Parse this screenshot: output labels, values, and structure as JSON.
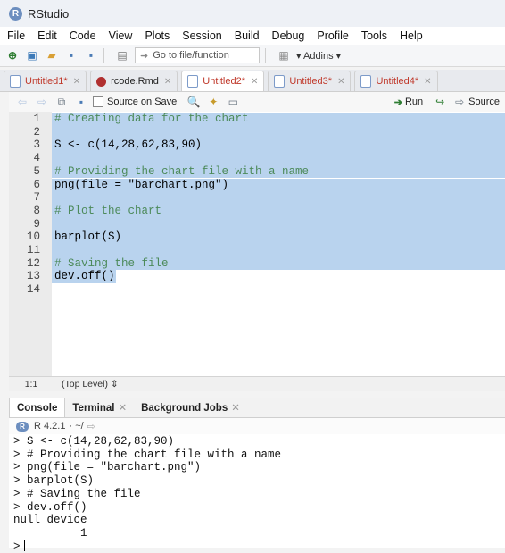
{
  "app": {
    "title": "RStudio",
    "logo_letter": "R"
  },
  "menu": [
    "File",
    "Edit",
    "Code",
    "View",
    "Plots",
    "Session",
    "Build",
    "Debug",
    "Profile",
    "Tools",
    "Help"
  ],
  "toolbar": {
    "goto_placeholder": "Go to file/function",
    "addins_label": "Addins"
  },
  "tabs": [
    {
      "label": "Untitled1*",
      "active": false
    },
    {
      "label": "rcode.Rmd",
      "active": false
    },
    {
      "label": "Untitled2*",
      "active": true
    },
    {
      "label": "Untitled3*",
      "active": false
    },
    {
      "label": "Untitled4*",
      "active": false
    }
  ],
  "editor_toolbar": {
    "source_on_save": "Source on Save",
    "run_label": "Run",
    "source_label": "Source"
  },
  "editor": {
    "lines": [
      {
        "n": "1",
        "text": "# Creating data for the chart"
      },
      {
        "n": "2",
        "text": ""
      },
      {
        "n": "3",
        "text": "S <- c(14,28,62,83,90)"
      },
      {
        "n": "4",
        "text": ""
      },
      {
        "n": "5",
        "text": "# Providing the chart file with a name"
      },
      {
        "n": "6",
        "text": "png(file = \"barchart.png\")"
      },
      {
        "n": "7",
        "text": ""
      },
      {
        "n": "8",
        "text": "# Plot the chart"
      },
      {
        "n": "9",
        "text": ""
      },
      {
        "n": "10",
        "text": "barplot(S)"
      },
      {
        "n": "11",
        "text": ""
      },
      {
        "n": "12",
        "text": "# Saving the file"
      },
      {
        "n": "13",
        "text": "dev.off()"
      },
      {
        "n": "14",
        "text": ""
      }
    ]
  },
  "status": {
    "position": "1:1",
    "scope": "(Top Level)"
  },
  "console_tabs": [
    {
      "label": "Console",
      "active": true
    },
    {
      "label": "Terminal",
      "active": false
    },
    {
      "label": "Background Jobs",
      "active": false
    }
  ],
  "console": {
    "version": "R 4.2.1",
    "path": "· ~/",
    "lines": [
      "> S <- c(14,28,62,83,90)",
      "> # Providing the chart file with a name",
      "> png(file = \"barchart.png\")",
      "> barplot(S)",
      "> # Saving the file",
      "> dev.off()",
      "null device",
      "          1",
      ">"
    ]
  }
}
